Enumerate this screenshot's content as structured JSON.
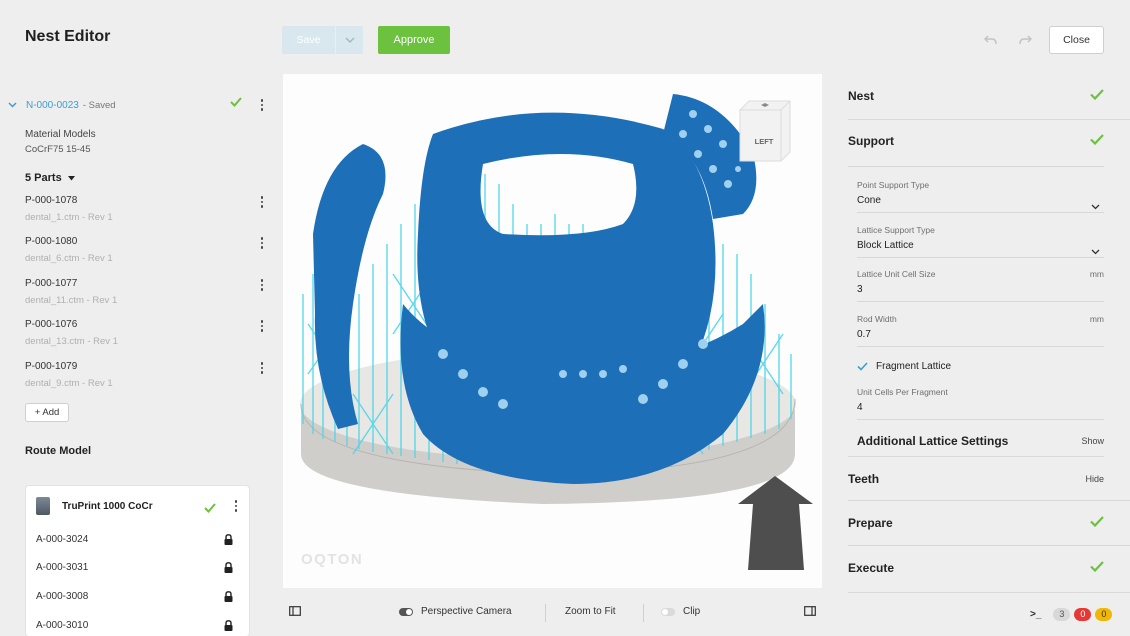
{
  "app": {
    "title": "Nest Editor"
  },
  "toolbar": {
    "save_label": "Save",
    "approve_label": "Approve",
    "close_label": "Close"
  },
  "nest": {
    "id": "N-000-0023",
    "status": "- Saved",
    "material_label": "Material Models",
    "material_value": "CoCrF75 15-45",
    "parts_label": "5 Parts",
    "parts": [
      {
        "id": "P-000-1078",
        "file": "dental_1.ctm - Rev 1"
      },
      {
        "id": "P-000-1080",
        "file": "dental_6.ctm - Rev 1"
      },
      {
        "id": "P-000-1077",
        "file": "dental_11.ctm - Rev 1"
      },
      {
        "id": "P-000-1076",
        "file": "dental_13.ctm - Rev 1"
      },
      {
        "id": "P-000-1079",
        "file": "dental_9.ctm - Rev 1"
      }
    ],
    "add_label": "+ Add"
  },
  "route": {
    "title": "Route Model",
    "machine": "TruPrint 1000 CoCr",
    "items": [
      "A-000-3024",
      "A-000-3031",
      "A-000-3008",
      "A-000-3010"
    ]
  },
  "viewport": {
    "cube_label": "LEFT",
    "watermark": "OQTON",
    "perspective_label": "Perspective Camera",
    "perspective_on": true,
    "zoom_label": "Zoom to Fit",
    "clip_label": "Clip",
    "clip_on": false
  },
  "panel": {
    "nest": {
      "title": "Nest",
      "done": true
    },
    "support": {
      "title": "Support",
      "done": true,
      "point_type_label": "Point Support Type",
      "point_type_value": "Cone",
      "lattice_type_label": "Lattice Support Type",
      "lattice_type_value": "Block Lattice",
      "cell_size_label": "Lattice Unit Cell Size",
      "cell_size_unit": "mm",
      "cell_size_value": "3",
      "rod_width_label": "Rod Width",
      "rod_width_unit": "mm",
      "rod_width_value": "0.7",
      "fragment_label": "Fragment Lattice",
      "fragment_checked": true,
      "cells_per_fragment_label": "Unit Cells Per Fragment",
      "cells_per_fragment_value": "4",
      "additional_label": "Additional Lattice Settings",
      "additional_link": "Show"
    },
    "teeth": {
      "title": "Teeth",
      "link": "Hide"
    },
    "prepare": {
      "title": "Prepare",
      "done": true
    },
    "execute": {
      "title": "Execute",
      "done": true
    }
  },
  "status": {
    "prompt": ">_",
    "info_count": "3",
    "error_count": "0",
    "warning_count": "0"
  },
  "colors": {
    "accent": "#3b9fd4",
    "success": "#6cc13f",
    "model": "#1d6fb8",
    "support": "#4fd6e8",
    "error": "#e53935",
    "warning": "#f2b705"
  }
}
